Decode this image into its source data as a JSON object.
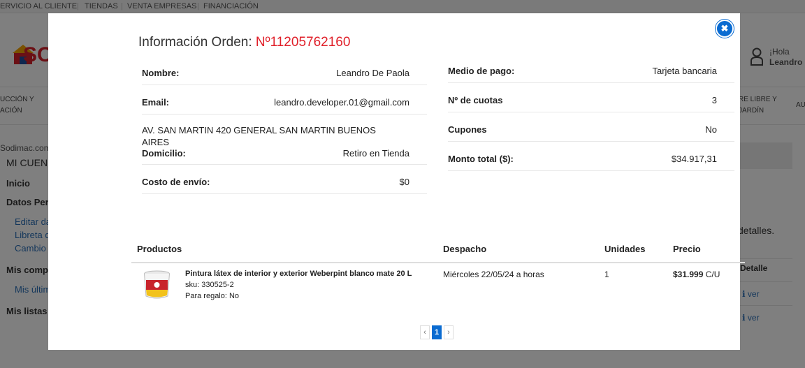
{
  "topbar": {
    "links": [
      "ERVICIO AL CLIENTE",
      "TIENDAS",
      "VENTA EMPRESAS",
      "FINANCIACIÓN"
    ]
  },
  "header": {
    "logo_text": "SO",
    "greeting": "¡Hola",
    "user_name": "Leandro"
  },
  "navbar": {
    "left_line1": "UCCIÓN Y",
    "left_line2": "ACIÓN",
    "right_line1": "RE LIBRE Y",
    "right_line2": "JARDÍN",
    "far_right": "AU"
  },
  "sidebar": {
    "site": "Sodimac.com",
    "account": "MI CUEN",
    "inicio": "Inicio",
    "datos": "Datos Per",
    "editar": "Editar da",
    "libreta": "Libreta d",
    "cambio": "Cambio",
    "compras": "Mis comp",
    "ultimas": "Mis últim",
    "listas": "Mis listas"
  },
  "background_right": {
    "detalles": "detalles.",
    "col_header": "Detalle",
    "ver1": "ver",
    "ver2": "ver"
  },
  "modal": {
    "title": "Información Orden: ",
    "order_number": "Nº11205762160",
    "left_fields": {
      "nombre_label": "Nombre:",
      "nombre_value": "Leandro De Paola",
      "email_label": "Email:",
      "email_value": "leandro.developer.01@gmail.com",
      "address": "AV. SAN MARTIN 420  GENERAL SAN MARTIN  BUENOS AIRES",
      "domicilio_label": "Domicilio:",
      "domicilio_value": "Retiro en Tienda",
      "envio_label": "Costo de envío:",
      "envio_value": "$0"
    },
    "right_fields": {
      "pago_label": "Medio de pago:",
      "pago_value": "Tarjeta bancaria",
      "cuotas_label": "Nº de cuotas",
      "cuotas_value": "3",
      "cupones_label": "Cupones",
      "cupones_value": "No",
      "monto_label": "Monto total ($):",
      "monto_value": "$34.917,31"
    },
    "products_header": {
      "productos": "Productos",
      "despacho": "Despacho",
      "unidades": "Unidades",
      "precio": "Precio"
    },
    "product": {
      "name": "Pintura látex de interior y exterior Weberpint blanco mate 20 L",
      "sku": "sku: 330525-2",
      "gift": "Para regalo: No",
      "despacho": "Miércoles  22/05/24   a  horas",
      "unidades": "1",
      "precio": "$31.999",
      "precio_unit": " C/U"
    },
    "pagination": {
      "prev": "‹",
      "current": "1",
      "next": "›"
    }
  },
  "colors": {
    "accent_blue": "#0a6bd1",
    "order_red": "#e0202a",
    "brand_red": "#d6202b"
  }
}
